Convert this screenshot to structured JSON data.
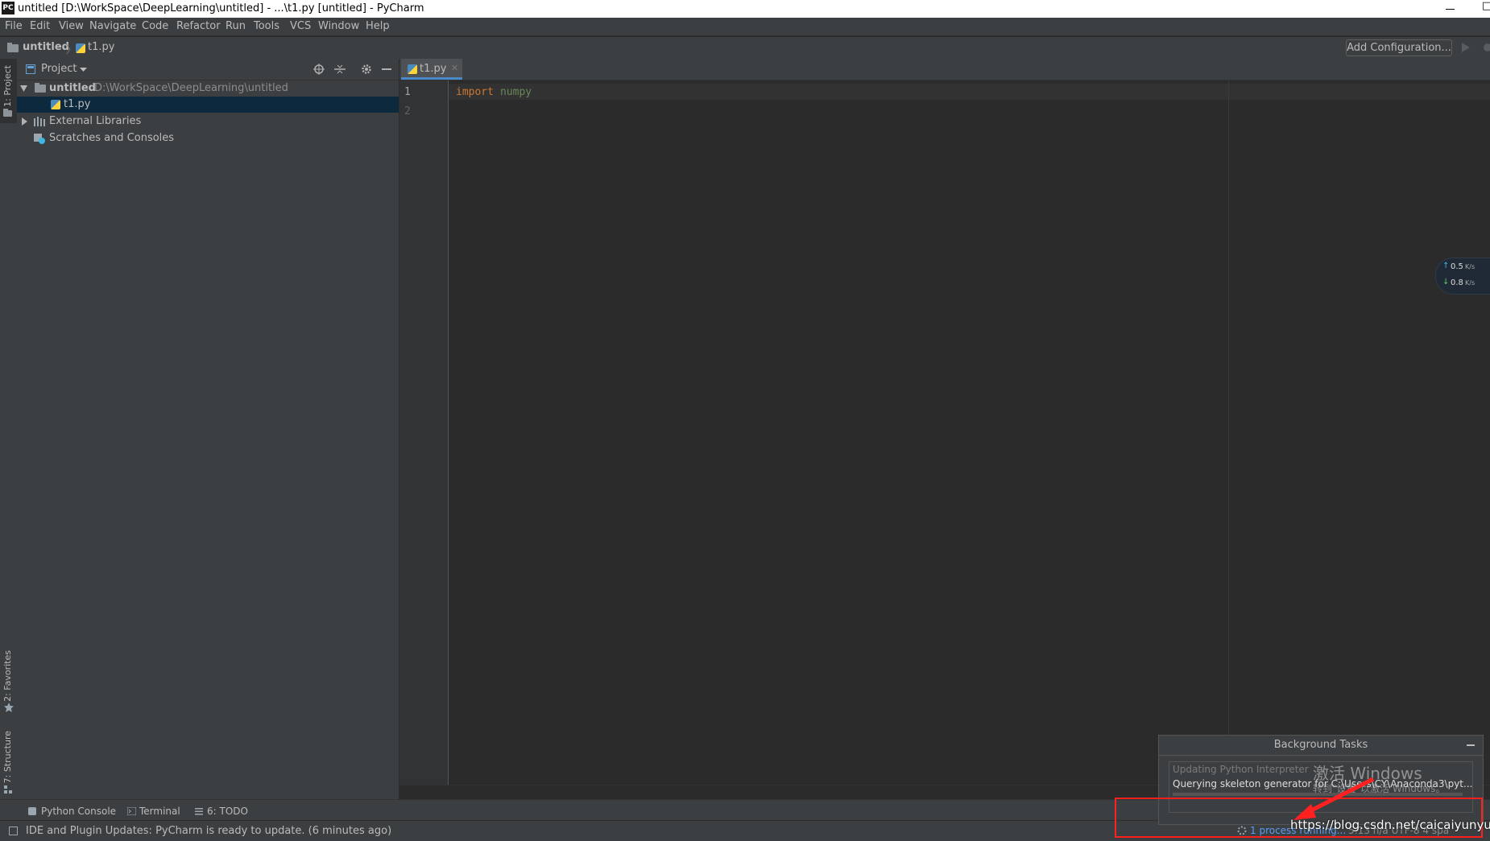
{
  "window": {
    "title": "untitled [D:\\WorkSpace\\DeepLearning\\untitled] - ...\\t1.py [untitled] - PyCharm",
    "logo": "PC",
    "min_glyph": "—",
    "max_glyph": "□"
  },
  "menu": [
    "File",
    "Edit",
    "View",
    "Navigate",
    "Code",
    "Refactor",
    "Run",
    "Tools",
    "VCS",
    "Window",
    "Help"
  ],
  "navbar": {
    "crumbs": [
      "untitled",
      "t1.py"
    ],
    "separator": "〉",
    "add_config": "Add Configuration..."
  },
  "left_stripe": {
    "project_tab": "1: Project",
    "favorites_tab": "2: Favorites",
    "structure_tab": "7: Structure"
  },
  "project_panel": {
    "title": "Project",
    "tree": {
      "root_name": "untitled",
      "root_path": "D:\\WorkSpace\\DeepLearning\\untitled",
      "file": "t1.py",
      "libraries": "External Libraries",
      "scratches": "Scratches and Consoles"
    }
  },
  "editor": {
    "tab": "t1.py",
    "lines": [
      "1",
      "2"
    ],
    "code_keyword": "import",
    "code_module": "numpy"
  },
  "bottom_tools": {
    "python_console": "Python Console",
    "terminal": "Terminal",
    "todo": "6: TODO"
  },
  "status": {
    "message": "IDE and Plugin Updates: PyCharm is ready to update. (6 minutes ago)",
    "process": "1 process running...",
    "right_fragment": "5:13   n/a   UTF-8   4 spa"
  },
  "background_tasks": {
    "title": "Background Tasks",
    "task1": "Updating Python Interpreter",
    "task2": "Querying skeleton generator for C:\\Users\\CY\\Anaconda3\\pyt..."
  },
  "network": {
    "up": "0.5",
    "down": "0.8",
    "unit": "K/s"
  },
  "overlay": {
    "watermark_line1": "激活 Windows",
    "watermark_line2": "转到\"设置\"以激活 Windows。",
    "url": "https://blog.csdn.net/caicaiyunyun"
  },
  "colors": {
    "keyword": "#cc7832",
    "module": "#6a8759",
    "selection": "#0d293e",
    "link": "#589df6",
    "annotation": "#ff2020"
  }
}
